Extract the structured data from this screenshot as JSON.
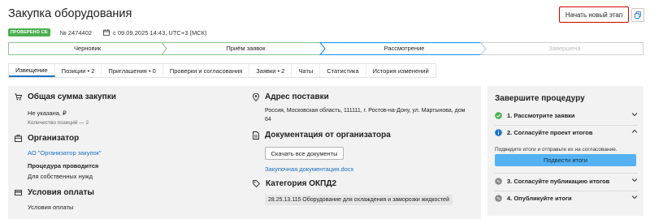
{
  "header": {
    "title": "Закупка оборудования",
    "badge": "ПРОВЕРЕНО СБ",
    "number": "№ 2474402",
    "date": "с 09.09.2025 14:43, UTC+3 (МСК)",
    "start_button": "Начать новый этап",
    "calendar_icon": "calendar-icon",
    "copy_icon": "copy-icon"
  },
  "stages": [
    {
      "label": "Черновик",
      "state": "done"
    },
    {
      "label": "Приём заявок",
      "state": "done"
    },
    {
      "label": "Рассмотрение",
      "state": "current"
    },
    {
      "label": "Завершена",
      "state": "future"
    }
  ],
  "tabs": [
    {
      "label": "Извещение",
      "active": true
    },
    {
      "label": "Позиции • 2"
    },
    {
      "label": "Приглашения • 0"
    },
    {
      "label": "Проверки и согласования"
    },
    {
      "label": "Заявки • 2"
    },
    {
      "label": "Чаты"
    },
    {
      "label": "Статистика"
    },
    {
      "label": "История изменений"
    }
  ],
  "summary": {
    "heading": "Общая сумма закупки",
    "value": "Не указана, ₽",
    "positions": "Количество позиций — 2"
  },
  "organizer": {
    "heading": "Организатор",
    "name": "АО \"Организатор закупок\"",
    "procedure_label": "Процедура проводится",
    "procedure_value": "Для собственных нужд"
  },
  "payment": {
    "heading": "Условия оплаты",
    "value": "Условия оплаты"
  },
  "address": {
    "heading": "Адрес поставки",
    "line1": "Россия, Московская область, 111111, г. Ростов-на-Дону, ул. Мартынова, дом",
    "line2": "64"
  },
  "docs": {
    "heading": "Документация от организатора",
    "download_button": "Скачать все документы",
    "file": "Закупочная документация.docx"
  },
  "okpd": {
    "heading": "Категория ОКПД2",
    "value": "28.25.13.115 Оборудование для охлаждения и заморозки жидкостей"
  },
  "procedure": {
    "title": "Завершите процедуру",
    "steps": [
      {
        "label": "1. Рассмотрите заявки",
        "status": "done"
      },
      {
        "label": "2. Согласуйте проект итогов",
        "status": "current"
      },
      {
        "label": "3. Согласуйте публикацию итогов",
        "status": "pending"
      },
      {
        "label": "4. Опубликуйте итоги",
        "status": "pending"
      }
    ],
    "current_desc": "Подведите итоги и отправьте их на согласование.",
    "action_button": "Подвести итоги"
  },
  "colors": {
    "accent": "#1a73c9",
    "badge": "#4caf50",
    "stage_active": "#2196f3",
    "primary_button": "#55b2f2",
    "highlight": "#d40000"
  }
}
